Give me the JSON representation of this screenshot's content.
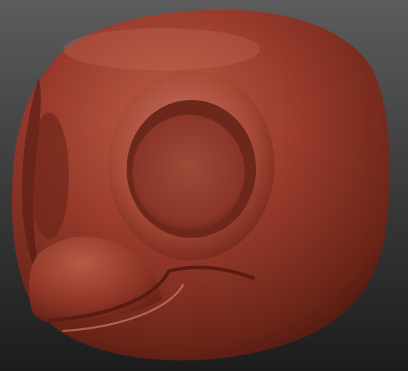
{
  "scene": {
    "subject": "sculpted-bird-head-mask",
    "material_color": "#9a3b2c",
    "highlight_color": "#c56650",
    "shadow_color": "#4d1710",
    "background_top": "#5c5c5c",
    "background_bottom": "#1c1c1c"
  }
}
